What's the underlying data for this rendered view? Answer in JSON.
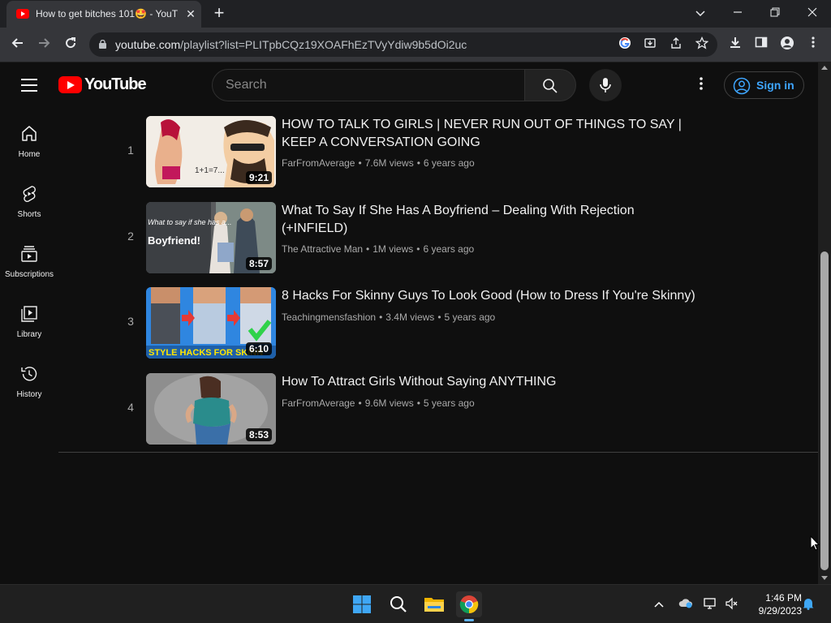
{
  "browser": {
    "tab_title": "How to get bitches 101🤩 - YouT",
    "tab_close": "✕",
    "new_tab": "+",
    "url_host": "youtube.com",
    "url_path": "/playlist?list=PLITpbCQz19XOAFhEzTVyYdiw9b5dOi2uc",
    "icons": [
      "back-icon",
      "forward-icon",
      "reload-icon",
      "lock-icon",
      "google-lens-icon",
      "install-icon",
      "share-icon",
      "bookmark-star-icon",
      "downloads-icon",
      "side-panel-icon",
      "profile-icon",
      "menu-icon"
    ]
  },
  "youtube": {
    "logo_text": "YouTube",
    "search_placeholder": "Search",
    "signin_label": "Sign in",
    "accent_color": "#3ea6ff",
    "sidebar": [
      {
        "label": "Home",
        "icon": "home-icon"
      },
      {
        "label": "Shorts",
        "icon": "shorts-icon"
      },
      {
        "label": "Subscriptions",
        "icon": "subscriptions-icon"
      },
      {
        "label": "Library",
        "icon": "library-icon"
      },
      {
        "label": "History",
        "icon": "history-icon"
      }
    ],
    "videos": [
      {
        "index": "1",
        "title": "HOW TO TALK TO GIRLS | NEVER RUN OUT OF THINGS TO SAY | KEEP A CONVERSATION GOING",
        "channel": "FarFromAverage",
        "views": "7.6M views",
        "age": "6 years ago",
        "duration": "9:21",
        "thumb_text": "1+1=7..."
      },
      {
        "index": "2",
        "title": "What To Say If She Has A Boyfriend – Dealing With Rejection (+INFIELD)",
        "channel": "The Attractive Man",
        "views": "1M views",
        "age": "6 years ago",
        "duration": "8:57",
        "thumb_text_small": "What to say if she has a...",
        "thumb_text_big": "Boyfriend!"
      },
      {
        "index": "3",
        "title": "8 Hacks For Skinny Guys To Look Good (How to Dress If You're Skinny)",
        "channel": "Teachingmensfashion",
        "views": "3.4M views",
        "age": "5 years ago",
        "duration": "6:10",
        "thumb_text": "STYLE HACKS FOR SKINN"
      },
      {
        "index": "4",
        "title": "How To Attract Girls Without Saying ANYTHING",
        "channel": "FarFromAverage",
        "views": "9.6M views",
        "age": "5 years ago",
        "duration": "8:53"
      }
    ],
    "meta_separator": "•"
  },
  "taskbar": {
    "time": "1:46 PM",
    "date": "9/29/2023"
  }
}
